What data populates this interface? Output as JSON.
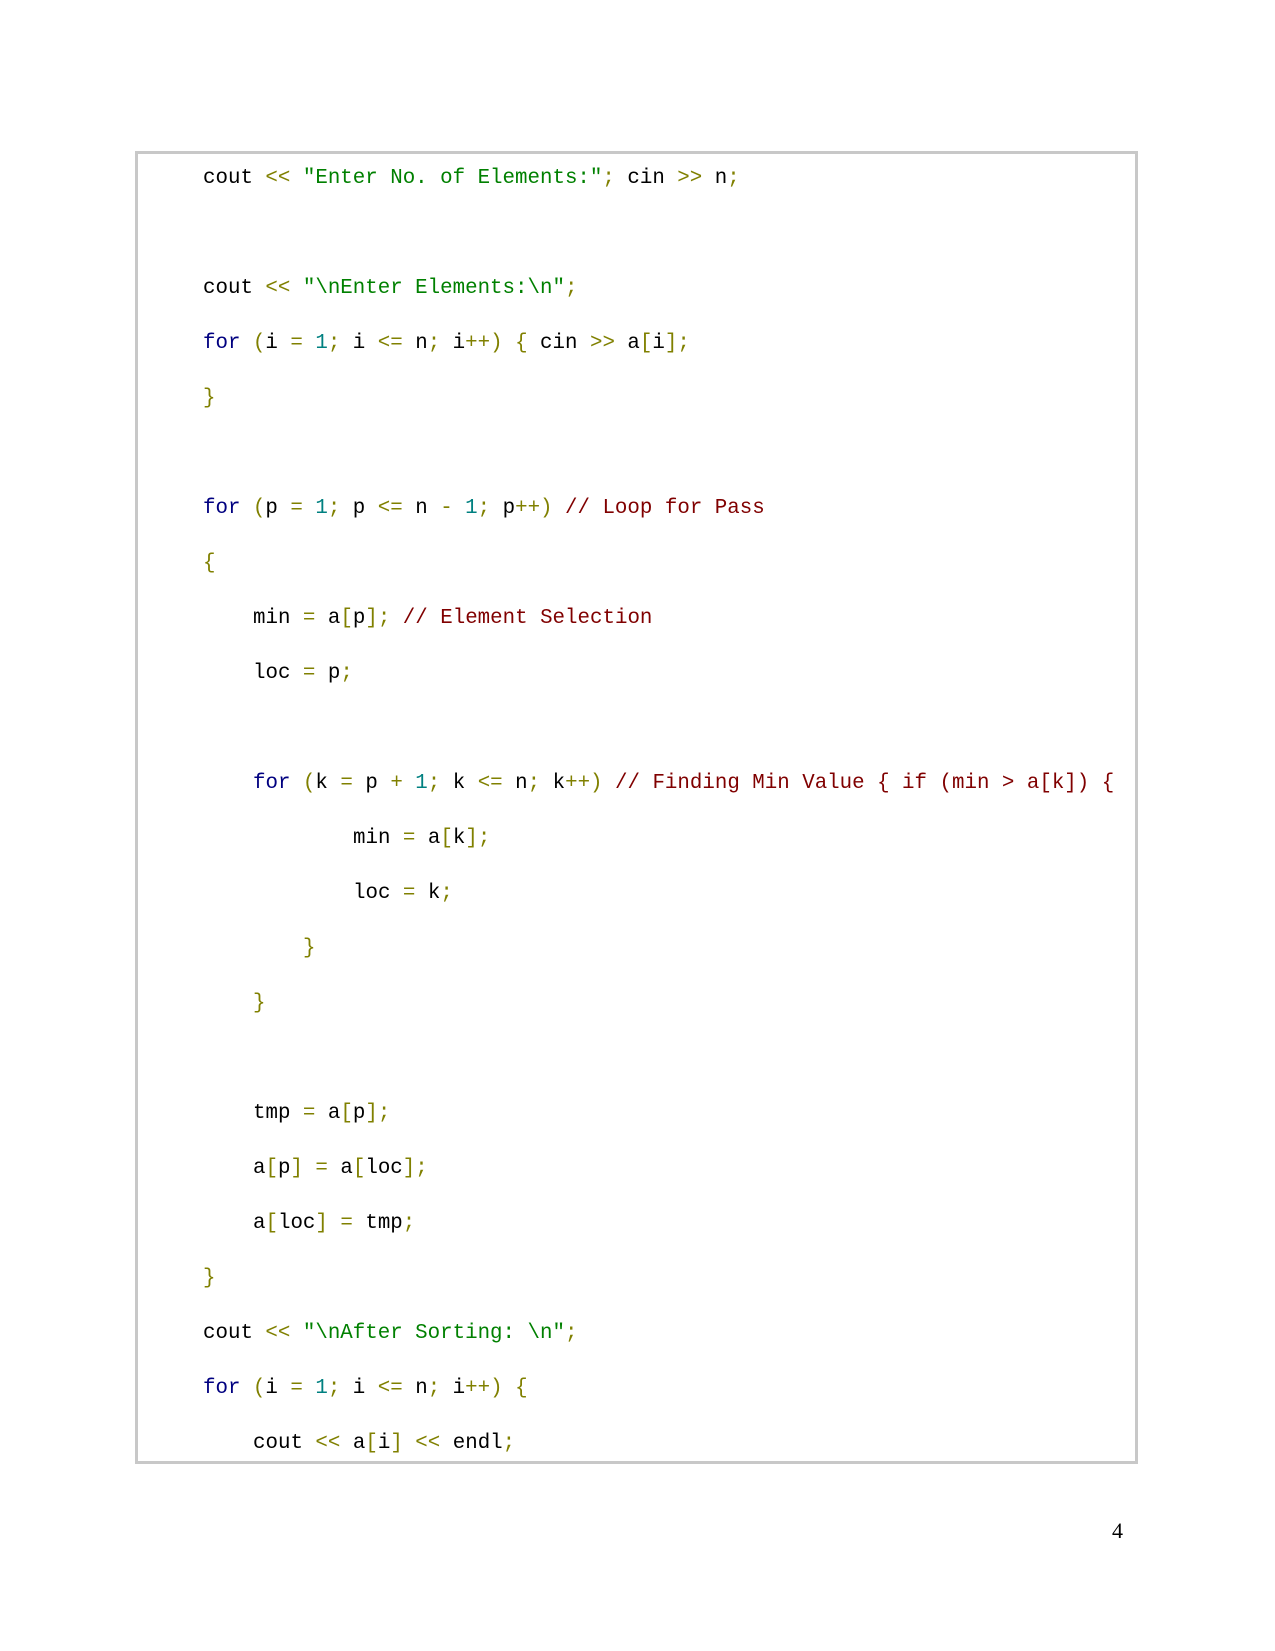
{
  "colors": {
    "keyword": "#000080",
    "operator": "#808000",
    "string": "#008000",
    "number": "#008080",
    "comment": "#800000",
    "identifier": "#000000",
    "border": "#c8c8c8"
  },
  "code_lines": [
    {
      "row": 0,
      "indent": 0,
      "tokens": [
        [
          "cout ",
          "id"
        ],
        [
          "<< ",
          "op"
        ],
        [
          "\"Enter No. of Elements:\"",
          "str"
        ],
        [
          "; ",
          "op"
        ],
        [
          "cin ",
          "id"
        ],
        [
          ">> ",
          "op"
        ],
        [
          "n",
          "id"
        ],
        [
          ";",
          "op"
        ]
      ]
    },
    {
      "row": 2,
      "indent": 0,
      "tokens": [
        [
          "cout ",
          "id"
        ],
        [
          "<< ",
          "op"
        ],
        [
          "\"\\nEnter Elements:\\n\"",
          "str"
        ],
        [
          ";",
          "op"
        ]
      ]
    },
    {
      "row": 3,
      "indent": 0,
      "tokens": [
        [
          "for ",
          "kw"
        ],
        [
          "(",
          "op"
        ],
        [
          "i ",
          "id"
        ],
        [
          "= ",
          "op"
        ],
        [
          "1",
          "num"
        ],
        [
          "; ",
          "op"
        ],
        [
          "i ",
          "id"
        ],
        [
          "<= ",
          "op"
        ],
        [
          "n",
          "id"
        ],
        [
          "; ",
          "op"
        ],
        [
          "i",
          "id"
        ],
        [
          "++) { ",
          "op"
        ],
        [
          "cin ",
          "id"
        ],
        [
          ">> ",
          "op"
        ],
        [
          "a",
          "id"
        ],
        [
          "[",
          "op"
        ],
        [
          "i",
          "id"
        ],
        [
          "];",
          "op"
        ]
      ]
    },
    {
      "row": 4,
      "indent": 0,
      "tokens": [
        [
          "}",
          "op"
        ]
      ]
    },
    {
      "row": 6,
      "indent": 0,
      "tokens": [
        [
          "for ",
          "kw"
        ],
        [
          "(",
          "op"
        ],
        [
          "p ",
          "id"
        ],
        [
          "= ",
          "op"
        ],
        [
          "1",
          "num"
        ],
        [
          "; ",
          "op"
        ],
        [
          "p ",
          "id"
        ],
        [
          "<= ",
          "op"
        ],
        [
          "n ",
          "id"
        ],
        [
          "- ",
          "op"
        ],
        [
          "1",
          "num"
        ],
        [
          "; ",
          "op"
        ],
        [
          "p",
          "id"
        ],
        [
          "++) ",
          "op"
        ],
        [
          "// Loop for Pass",
          "cm"
        ]
      ]
    },
    {
      "row": 7,
      "indent": 0,
      "tokens": [
        [
          "{",
          "op"
        ]
      ]
    },
    {
      "row": 8,
      "indent": 1,
      "tokens": [
        [
          "min ",
          "id"
        ],
        [
          "= ",
          "op"
        ],
        [
          "a",
          "id"
        ],
        [
          "[",
          "op"
        ],
        [
          "p",
          "id"
        ],
        [
          "]; ",
          "op"
        ],
        [
          "// Element Selection",
          "cm"
        ]
      ]
    },
    {
      "row": 9,
      "indent": 1,
      "tokens": [
        [
          "loc ",
          "id"
        ],
        [
          "= ",
          "op"
        ],
        [
          "p",
          "id"
        ],
        [
          ";",
          "op"
        ]
      ]
    },
    {
      "row": 11,
      "indent": 1,
      "tokens": [
        [
          "for ",
          "kw"
        ],
        [
          "(",
          "op"
        ],
        [
          "k ",
          "id"
        ],
        [
          "= ",
          "op"
        ],
        [
          "p ",
          "id"
        ],
        [
          "+ ",
          "op"
        ],
        [
          "1",
          "num"
        ],
        [
          "; ",
          "op"
        ],
        [
          "k ",
          "id"
        ],
        [
          "<= ",
          "op"
        ],
        [
          "n",
          "id"
        ],
        [
          "; ",
          "op"
        ],
        [
          "k",
          "id"
        ],
        [
          "++) ",
          "op"
        ],
        [
          "// Finding Min Value { if (min > a[k]) {",
          "cm"
        ]
      ]
    },
    {
      "row": 12,
      "indent": 3,
      "tokens": [
        [
          "min ",
          "id"
        ],
        [
          "= ",
          "op"
        ],
        [
          "a",
          "id"
        ],
        [
          "[",
          "op"
        ],
        [
          "k",
          "id"
        ],
        [
          "];",
          "op"
        ]
      ]
    },
    {
      "row": 13,
      "indent": 3,
      "tokens": [
        [
          "loc ",
          "id"
        ],
        [
          "= ",
          "op"
        ],
        [
          "k",
          "id"
        ],
        [
          ";",
          "op"
        ]
      ]
    },
    {
      "row": 14,
      "indent": 2,
      "tokens": [
        [
          "}",
          "op"
        ]
      ]
    },
    {
      "row": 15,
      "indent": 1,
      "tokens": [
        [
          "}",
          "op"
        ]
      ]
    },
    {
      "row": 17,
      "indent": 1,
      "tokens": [
        [
          "tmp ",
          "id"
        ],
        [
          "= ",
          "op"
        ],
        [
          "a",
          "id"
        ],
        [
          "[",
          "op"
        ],
        [
          "p",
          "id"
        ],
        [
          "];",
          "op"
        ]
      ]
    },
    {
      "row": 18,
      "indent": 1,
      "tokens": [
        [
          "a",
          "id"
        ],
        [
          "[",
          "op"
        ],
        [
          "p",
          "id"
        ],
        [
          "] = ",
          "op"
        ],
        [
          "a",
          "id"
        ],
        [
          "[",
          "op"
        ],
        [
          "loc",
          "id"
        ],
        [
          "];",
          "op"
        ]
      ]
    },
    {
      "row": 19,
      "indent": 1,
      "tokens": [
        [
          "a",
          "id"
        ],
        [
          "[",
          "op"
        ],
        [
          "loc",
          "id"
        ],
        [
          "] = ",
          "op"
        ],
        [
          "tmp",
          "id"
        ],
        [
          ";",
          "op"
        ]
      ]
    },
    {
      "row": 20,
      "indent": 0,
      "tokens": [
        [
          "}",
          "op"
        ]
      ]
    },
    {
      "row": 21,
      "indent": 0,
      "tokens": [
        [
          "cout ",
          "id"
        ],
        [
          "<< ",
          "op"
        ],
        [
          "\"\\nAfter Sorting: \\n\"",
          "str"
        ],
        [
          ";",
          "op"
        ]
      ]
    },
    {
      "row": 22,
      "indent": 0,
      "tokens": [
        [
          "for ",
          "kw"
        ],
        [
          "(",
          "op"
        ],
        [
          "i ",
          "id"
        ],
        [
          "= ",
          "op"
        ],
        [
          "1",
          "num"
        ],
        [
          "; ",
          "op"
        ],
        [
          "i ",
          "id"
        ],
        [
          "<= ",
          "op"
        ],
        [
          "n",
          "id"
        ],
        [
          "; ",
          "op"
        ],
        [
          "i",
          "id"
        ],
        [
          "++) {",
          "op"
        ]
      ]
    },
    {
      "row": 23,
      "indent": 1,
      "tokens": [
        [
          "cout ",
          "id"
        ],
        [
          "<< ",
          "op"
        ],
        [
          "a",
          "id"
        ],
        [
          "[",
          "op"
        ],
        [
          "i",
          "id"
        ],
        [
          "] ",
          "op"
        ],
        [
          "<< ",
          "op"
        ],
        [
          "endl",
          "id"
        ],
        [
          ";",
          "op"
        ]
      ]
    }
  ],
  "page_number": "4"
}
